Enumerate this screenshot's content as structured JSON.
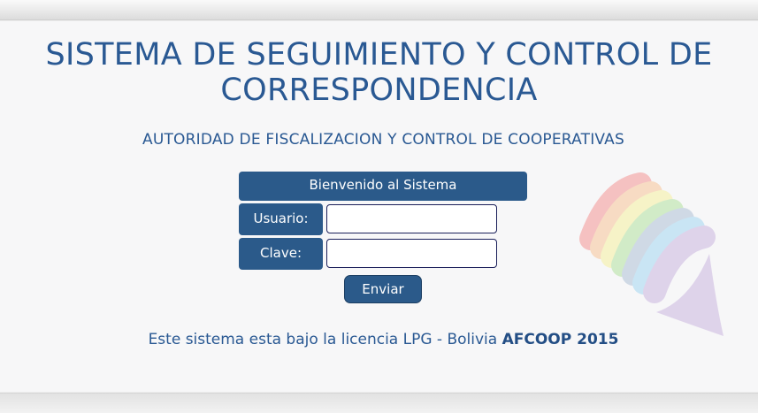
{
  "header": {
    "title": "SISTEMA DE SEGUIMIENTO Y CONTROL DE CORRESPONDENCIA",
    "subtitle": "AUTORIDAD DE FISCALIZACION Y CONTROL DE COOPERATIVAS"
  },
  "login": {
    "welcome": "Bienvenido al Sistema",
    "user_label": "Usuario:",
    "user_value": "",
    "password_label": "Clave:",
    "password_value": "",
    "submit_label": "Enviar"
  },
  "footer": {
    "text": "Este sistema esta bajo la licencia LPG - Bolivia ",
    "brand": "AFCOOP 2015"
  },
  "logo": {
    "icon": "rainbow-wing-logo",
    "colors": [
      "#f26a6a",
      "#f8b070",
      "#f6ee7a",
      "#95d97a",
      "#8fa9c8",
      "#7fc8ee",
      "#b79ad6"
    ]
  }
}
